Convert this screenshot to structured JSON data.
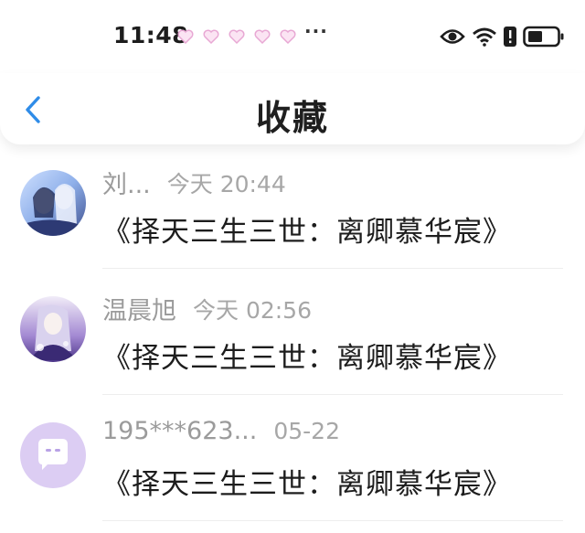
{
  "status_bar": {
    "time": "11:48",
    "more": "···",
    "notification_icons": [
      "heart-icon",
      "heart-icon",
      "heart-icon",
      "heart-icon",
      "heart-icon"
    ]
  },
  "nav": {
    "title": "收藏",
    "back_icon": "chevron-left-icon",
    "accent_color": "#2f8ce8"
  },
  "favorites": [
    {
      "name": "刘...",
      "time": "今天 20:44",
      "title": "《择天三生三世：离卿慕华宸》",
      "avatar": "anime-couple"
    },
    {
      "name": "温晨旭",
      "time": "今天 02:56",
      "title": "《择天三生三世：离卿慕华宸》",
      "avatar": "anime-girl"
    },
    {
      "name": "195***623...",
      "time": "05-22",
      "title": "《择天三生三世：离卿慕华宸》",
      "avatar": "chat-bubble-icon"
    }
  ]
}
